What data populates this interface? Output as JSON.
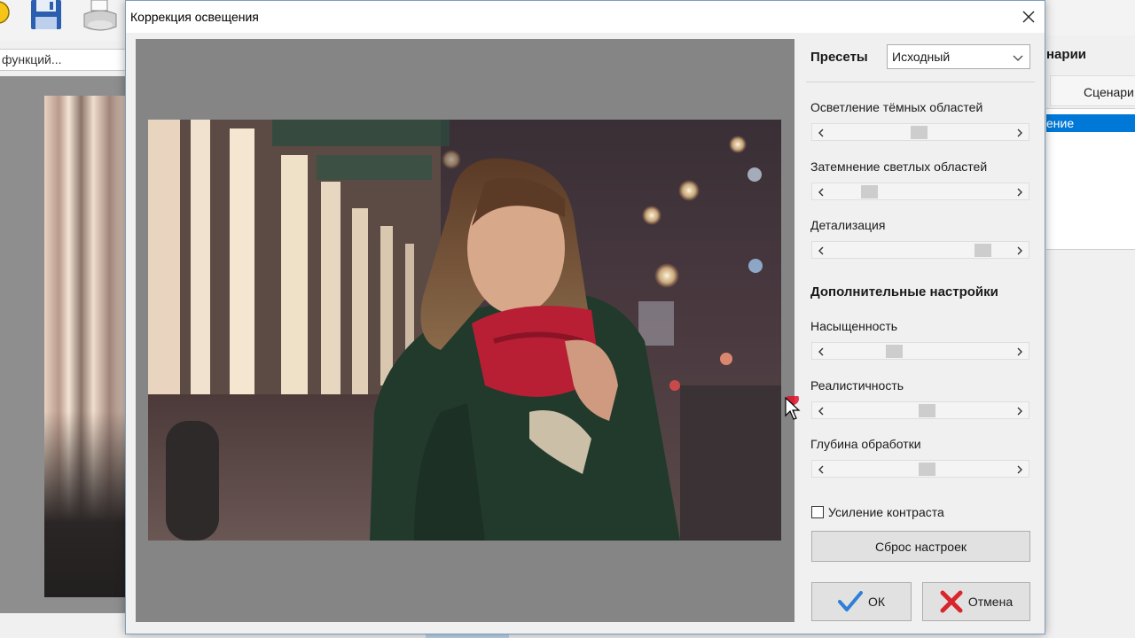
{
  "background_app": {
    "search_text": "функций...",
    "right_panel_title": "нарии",
    "right_tab_label": "Сценари",
    "right_list_selected": "ение"
  },
  "dialog": {
    "title": "Коррекция освещения",
    "presets": {
      "label": "Пресеты",
      "selected": "Исходный"
    },
    "sliders": [
      {
        "label": "Осветление тёмных областей",
        "value": 0.49
      },
      {
        "label": "Затемнение светлых областей",
        "value": 0.19
      },
      {
        "label": "Детализация",
        "value": 0.88
      },
      {
        "label": "Насыщенность",
        "value": 0.34
      },
      {
        "label": "Реалистичность",
        "value": 0.54
      },
      {
        "label": "Глубина обработки",
        "value": 0.54
      }
    ],
    "advanced_section_title": "Дополнительные настройки",
    "contrast_checkbox": {
      "label": "Усиление контраста",
      "checked": false
    },
    "reset_button": "Сброс настроек",
    "ok_button": "ОК",
    "cancel_button": "Отмена",
    "colors": {
      "ok_check": "#2f7fd6",
      "cancel_cross": "#d9262c",
      "selection": "#0078d7"
    }
  }
}
